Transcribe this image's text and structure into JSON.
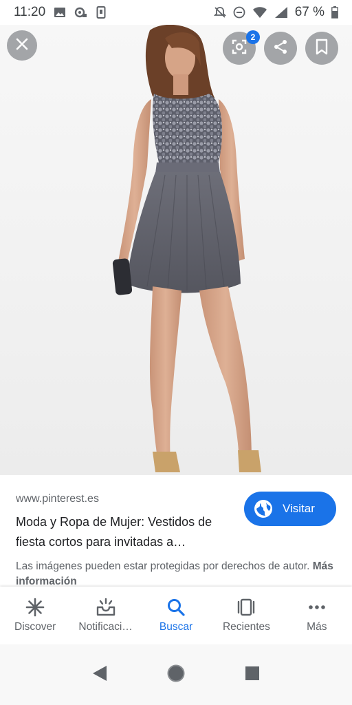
{
  "status_bar": {
    "time": "11:20",
    "battery": "67 %"
  },
  "image_viewer": {
    "lens_badge": "2",
    "icons": {
      "close": "close-icon",
      "lens": "lens-icon",
      "share": "share-icon",
      "save": "bookmark-icon"
    }
  },
  "result": {
    "source": "www.pinterest.es",
    "title": "Moda y Ropa de Mujer: Vestidos de fiesta cortos para invitadas a…",
    "visit_label": "Visitar",
    "copyright_text": "Las imágenes pueden estar protegidas por derechos de autor.",
    "more_info": "Más información"
  },
  "bottom_nav": {
    "items": [
      {
        "label": "Discover",
        "icon": "asterisk-icon"
      },
      {
        "label": "Notificaci…",
        "icon": "inbox-bell-icon"
      },
      {
        "label": "Buscar",
        "icon": "search-icon"
      },
      {
        "label": "Recientes",
        "icon": "recent-cards-icon"
      },
      {
        "label": "Más",
        "icon": "more-dots-icon"
      }
    ],
    "active_index": 2
  },
  "colors": {
    "accent": "#1a73e8",
    "text_primary": "#202124",
    "text_secondary": "#5f6368"
  }
}
